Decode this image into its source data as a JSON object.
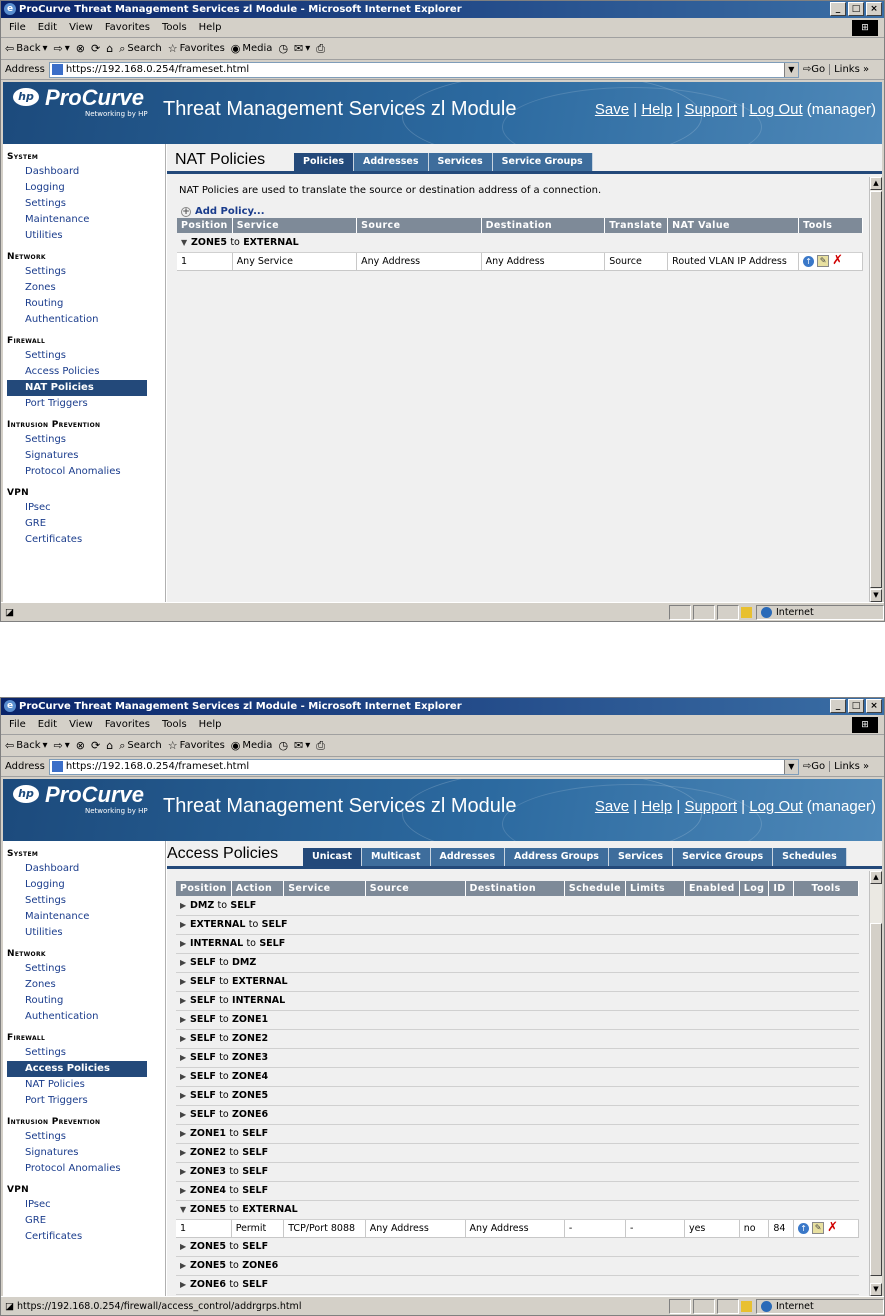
{
  "browser": {
    "window_title": "ProCurve Threat Management Services zl Module - Microsoft Internet Explorer",
    "menu": [
      "File",
      "Edit",
      "View",
      "Favorites",
      "Tools",
      "Help"
    ],
    "toolbar": {
      "back": "Back",
      "search": "Search",
      "favorites": "Favorites",
      "media": "Media"
    },
    "address_label": "Address",
    "address_url": "https://192.168.0.254/frameset.html",
    "go": "Go",
    "links": "Links",
    "zone": "Internet",
    "window_buttons": [
      "_",
      "□",
      "×"
    ]
  },
  "banner": {
    "logo_hp": "hp",
    "logo_brand": "ProCurve",
    "logo_sub": "Networking by HP",
    "title": "Threat Management Services zl Module",
    "links": [
      "Save",
      "Help",
      "Support",
      "Log Out"
    ],
    "separator": "|",
    "user": "(manager)"
  },
  "sidebar": {
    "sections": [
      {
        "title": "System",
        "items": [
          "Dashboard",
          "Logging",
          "Settings",
          "Maintenance",
          "Utilities"
        ]
      },
      {
        "title": "Network",
        "items": [
          "Settings",
          "Zones",
          "Routing",
          "Authentication"
        ]
      },
      {
        "title": "Firewall",
        "items": [
          "Settings",
          "Access Policies",
          "NAT Policies",
          "Port Triggers"
        ]
      },
      {
        "title": "Intrusion Prevention",
        "items": [
          "Settings",
          "Signatures",
          "Protocol Anomalies"
        ]
      },
      {
        "title": "VPN",
        "items": [
          "IPsec",
          "GRE",
          "Certificates"
        ]
      }
    ]
  },
  "screen1": {
    "selected_nav": "NAT Policies",
    "page_title": "NAT Policies",
    "tabs": [
      "Policies",
      "Addresses",
      "Services",
      "Service Groups"
    ],
    "active_tab": "Policies",
    "description": "NAT Policies are used to translate the source or destination address of a connection.",
    "add_policy": "Add Policy...",
    "columns": [
      "Position",
      "Service",
      "Source",
      "Destination",
      "Translate",
      "NAT Value",
      "Tools"
    ],
    "group": {
      "from": "ZONE5",
      "to_word": "to",
      "dest": "EXTERNAL"
    },
    "rows": [
      {
        "position": "1",
        "service": "Any Service",
        "source": "Any Address",
        "destination": "Any Address",
        "translate": "Source",
        "nat_value": "Routed VLAN IP Address"
      }
    ],
    "status_text": ""
  },
  "screen2": {
    "selected_nav": "Access Policies",
    "page_title": "Access Policies",
    "tabs": [
      "Unicast",
      "Multicast",
      "Addresses",
      "Address Groups",
      "Services",
      "Service Groups",
      "Schedules"
    ],
    "active_tab": "Unicast",
    "columns": [
      "Position",
      "Action",
      "Service",
      "Source",
      "Destination",
      "Schedule",
      "Limits",
      "Enabled",
      "Log",
      "ID",
      "Tools"
    ],
    "groups": [
      {
        "from": "DMZ",
        "dest": "SELF",
        "expanded": false
      },
      {
        "from": "EXTERNAL",
        "dest": "SELF",
        "expanded": false
      },
      {
        "from": "INTERNAL",
        "dest": "SELF",
        "expanded": false
      },
      {
        "from": "SELF",
        "dest": "DMZ",
        "expanded": false
      },
      {
        "from": "SELF",
        "dest": "EXTERNAL",
        "expanded": false
      },
      {
        "from": "SELF",
        "dest": "INTERNAL",
        "expanded": false
      },
      {
        "from": "SELF",
        "dest": "ZONE1",
        "expanded": false
      },
      {
        "from": "SELF",
        "dest": "ZONE2",
        "expanded": false
      },
      {
        "from": "SELF",
        "dest": "ZONE3",
        "expanded": false
      },
      {
        "from": "SELF",
        "dest": "ZONE4",
        "expanded": false
      },
      {
        "from": "SELF",
        "dest": "ZONE5",
        "expanded": false
      },
      {
        "from": "SELF",
        "dest": "ZONE6",
        "expanded": false
      },
      {
        "from": "ZONE1",
        "dest": "SELF",
        "expanded": false
      },
      {
        "from": "ZONE2",
        "dest": "SELF",
        "expanded": false
      },
      {
        "from": "ZONE3",
        "dest": "SELF",
        "expanded": false
      },
      {
        "from": "ZONE4",
        "dest": "SELF",
        "expanded": false
      },
      {
        "from": "ZONE5",
        "dest": "EXTERNAL",
        "expanded": true,
        "rows": [
          {
            "position": "1",
            "action": "Permit",
            "service": "TCP/Port 8088",
            "source": "Any Address",
            "destination": "Any Address",
            "schedule": "-",
            "limits": "-",
            "enabled": "yes",
            "log": "no",
            "id": "84"
          }
        ]
      },
      {
        "from": "ZONE5",
        "dest": "SELF",
        "expanded": false
      },
      {
        "from": "ZONE5",
        "dest": "ZONE6",
        "expanded": false
      },
      {
        "from": "ZONE6",
        "dest": "SELF",
        "expanded": false
      }
    ],
    "to_word": "to",
    "status_text": "https://192.168.0.254/firewall/access_control/addrgrps.html"
  }
}
